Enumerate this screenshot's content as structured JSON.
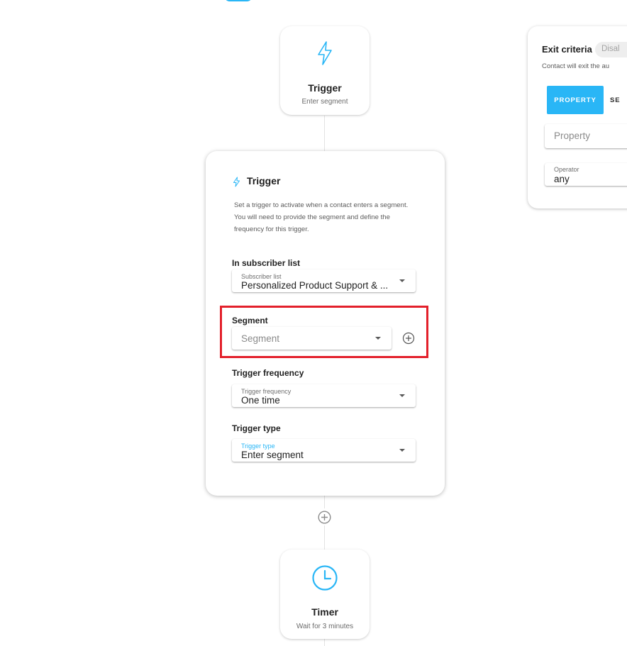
{
  "nodes": {
    "trigger": {
      "title": "Trigger",
      "subtitle": "Enter segment"
    },
    "timer": {
      "title": "Timer",
      "subtitle": "Wait for 3 minutes"
    }
  },
  "panel": {
    "title": "Trigger",
    "description": "Set a trigger to activate when a contact enters a segment. You will need to provide the segment and define the frequency for this trigger.",
    "subscriber_list": {
      "section_label": "In subscriber list",
      "field_label": "Subscriber list",
      "value": "Personalized Product Support & ..."
    },
    "segment": {
      "section_label": "Segment",
      "placeholder": "Segment"
    },
    "frequency": {
      "section_label": "Trigger frequency",
      "field_label": "Trigger frequency",
      "value": "One time"
    },
    "type": {
      "section_label": "Trigger type",
      "field_label": "Trigger type",
      "value": "Enter segment"
    }
  },
  "exit_criteria": {
    "title": "Exit criteria",
    "status_badge": "Disal",
    "description": "Contact will exit the au",
    "tabs": [
      "PROPERTY",
      "SE"
    ],
    "property_placeholder": "Property",
    "operator_label": "Operator",
    "operator_value": "any"
  },
  "colors": {
    "accent": "#29b6f6",
    "highlight": "#e3202b"
  },
  "icons": {
    "trigger": "lightning-icon",
    "timer": "clock-icon",
    "add": "add-circle-icon",
    "caret": "caret-down-icon"
  }
}
